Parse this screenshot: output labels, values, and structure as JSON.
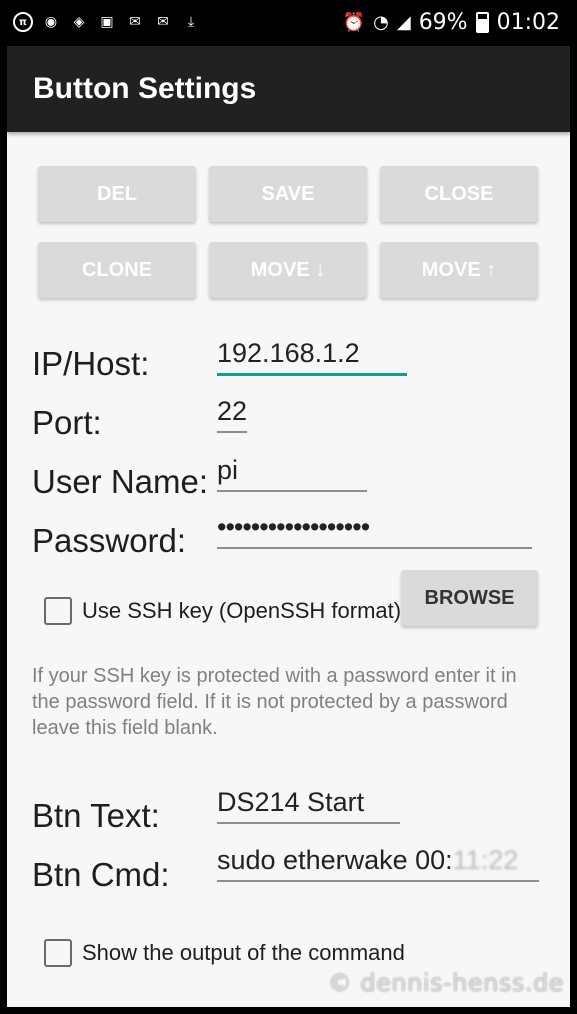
{
  "status_bar": {
    "left_icons": [
      "pi-icon",
      "messenger-icon",
      "navigation-icon",
      "gallery-icon",
      "mail-icon",
      "mail-icon",
      "download-done-icon"
    ],
    "battery": "69%",
    "time": "01:02"
  },
  "app_bar": {
    "title": "Button Settings"
  },
  "buttons": {
    "del": "DEL",
    "save": "SAVE",
    "close": "CLOSE",
    "clone": "CLONE",
    "move_down": "MOVE ↓",
    "move_up": "MOVE ↑",
    "browse": "BROWSE"
  },
  "form": {
    "ip_label": "IP/Host:",
    "ip_value": "192.168.1.2",
    "port_label": "Port:",
    "port_value": "22",
    "user_label": "User Name:",
    "user_value": "pi",
    "password_label": "Password:",
    "password_value": "••••••••••••••••••",
    "ssh_key_label": "Use SSH key (OpenSSH format)",
    "ssh_key_checked": false,
    "hint": "If your SSH key is protected with a password enter it in the password field. If it is not protected by a password leave this field blank.",
    "btn_text_label": "Btn Text:",
    "btn_text_value": "DS214 Start",
    "btn_cmd_label": "Btn Cmd:",
    "btn_cmd_value": "sudo etherwake 00:",
    "btn_cmd_value_obscured": "11:22",
    "show_output_label": "Show the output of the command",
    "show_output_checked": false
  },
  "watermark": "© dennis-henss.de",
  "colors": {
    "accent": "#159e8e",
    "app_bar": "#212121",
    "button_bg": "#dadada"
  }
}
